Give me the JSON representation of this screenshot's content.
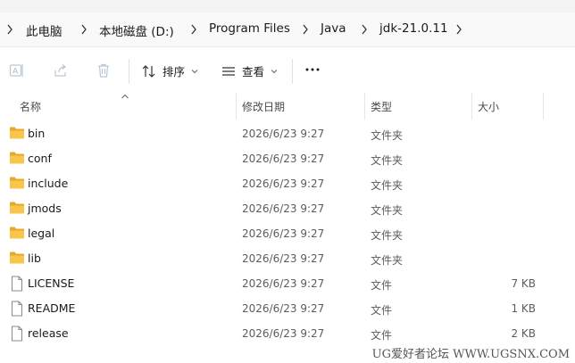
{
  "breadcrumb": {
    "items": [
      {
        "label": "此电脑"
      },
      {
        "label": "本地磁盘 (D:)"
      },
      {
        "label": "Program Files"
      },
      {
        "label": "Java"
      },
      {
        "label": "jdk-21.0.11"
      }
    ]
  },
  "toolbar": {
    "sort_label": "排序",
    "view_label": "查看",
    "more_label": "···"
  },
  "columns": {
    "name": "名称",
    "date": "修改日期",
    "type": "类型",
    "size": "大小"
  },
  "files": [
    {
      "name": "bin",
      "date": "2026/6/23 9:27",
      "type": "文件夹",
      "size": "",
      "icon": "folder-icon"
    },
    {
      "name": "conf",
      "date": "2026/6/23 9:27",
      "type": "文件夹",
      "size": "",
      "icon": "folder-icon"
    },
    {
      "name": "include",
      "date": "2026/6/23 9:27",
      "type": "文件夹",
      "size": "",
      "icon": "folder-icon"
    },
    {
      "name": "jmods",
      "date": "2026/6/23 9:27",
      "type": "文件夹",
      "size": "",
      "icon": "folder-icon"
    },
    {
      "name": "legal",
      "date": "2026/6/23 9:27",
      "type": "文件夹",
      "size": "",
      "icon": "folder-icon"
    },
    {
      "name": "lib",
      "date": "2026/6/23 9:27",
      "type": "文件夹",
      "size": "",
      "icon": "folder-icon"
    },
    {
      "name": "LICENSE",
      "date": "2026/6/23 9:27",
      "type": "文件",
      "size": "7 KB",
      "icon": "file-icon"
    },
    {
      "name": "README",
      "date": "2026/6/23 9:27",
      "type": "文件",
      "size": "1 KB",
      "icon": "file-icon"
    },
    {
      "name": "release",
      "date": "2026/6/23 9:27",
      "type": "文件",
      "size": "2 KB",
      "icon": "file-icon"
    }
  ],
  "watermark": "UG爱好者论坛 WWW.UGSNX.COM",
  "colors": {
    "folder": "#f8c64b",
    "folder_dark": "#e9a82a"
  }
}
